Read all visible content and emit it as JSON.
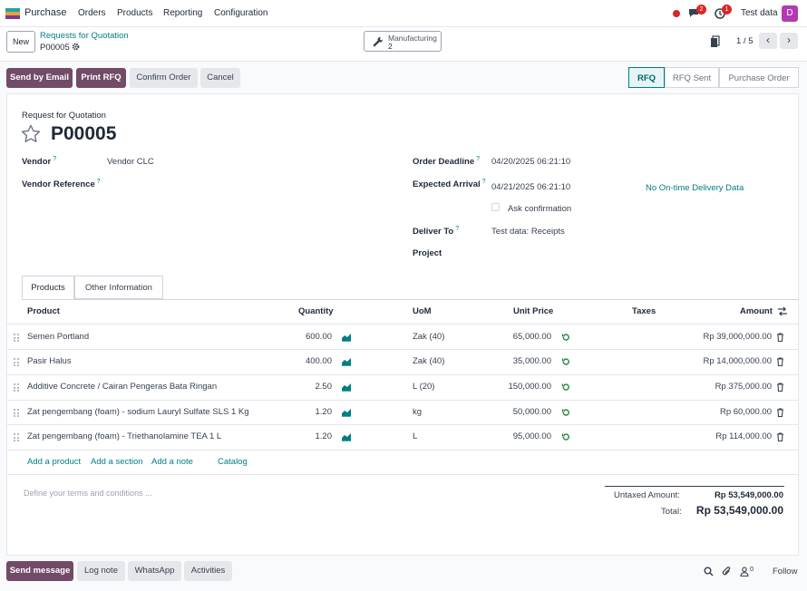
{
  "navbar": {
    "app_name": "Purchase",
    "menu": [
      "Orders",
      "Products",
      "Reporting",
      "Configuration"
    ],
    "messages_count": "2",
    "activities_count": "1",
    "company": "Test data",
    "avatar_letter": "D"
  },
  "control": {
    "new_label": "New",
    "breadcrumb": "Requests for Quotation",
    "record": "P00005",
    "smart_button": {
      "label": "Manufacturing",
      "count": "2"
    },
    "pager": "1 / 5"
  },
  "actions": {
    "send_email": "Send by Email",
    "print_rfq": "Print RFQ",
    "confirm": "Confirm Order",
    "cancel": "Cancel"
  },
  "stages": [
    "RFQ",
    "RFQ Sent",
    "Purchase Order"
  ],
  "form": {
    "doc_type": "Request for Quotation",
    "name": "P00005",
    "vendor_label": "Vendor",
    "vendor": "Vendor CLC",
    "vendor_ref_label": "Vendor Reference",
    "order_deadline_label": "Order Deadline",
    "order_deadline": "04/20/2025 06:21:10",
    "expected_arrival_label": "Expected Arrival",
    "expected_arrival": "04/21/2025 06:21:10",
    "ontime_link": "No On-time Delivery Data",
    "ask_confirmation": "Ask confirmation",
    "deliver_to_label": "Deliver To",
    "deliver_to": "Test data: Receipts",
    "project_label": "Project"
  },
  "tabs": [
    "Products",
    "Other Information"
  ],
  "table": {
    "headers": {
      "product": "Product",
      "quantity": "Quantity",
      "uom": "UoM",
      "unit_price": "Unit Price",
      "taxes": "Taxes",
      "amount": "Amount"
    },
    "rows": [
      {
        "product": "Semen Portland",
        "quantity": "600.00",
        "uom": "Zak (40)",
        "price": "65,000.00",
        "amount": "Rp 39,000,000.00"
      },
      {
        "product": "Pasir Halus",
        "quantity": "400.00",
        "uom": "Zak (40)",
        "price": "35,000.00",
        "amount": "Rp 14,000,000.00"
      },
      {
        "product": "Additive Concrete / Cairan Pengeras Bata Ringan",
        "quantity": "2.50",
        "uom": "L (20)",
        "price": "150,000.00",
        "amount": "Rp 375,000.00"
      },
      {
        "product": "Zat pengembang (foam) - sodium Lauryl Sulfate SLS 1 Kg",
        "quantity": "1.20",
        "uom": "kg",
        "price": "50,000.00",
        "amount": "Rp 60,000.00"
      },
      {
        "product": "Zat pengembang (foam) - Triethanolamine TEA 1 L",
        "quantity": "1.20",
        "uom": "L",
        "price": "95,000.00",
        "amount": "Rp 114,000.00"
      }
    ],
    "add_product": "Add a product",
    "add_section": "Add a section",
    "add_note": "Add a note",
    "catalog": "Catalog"
  },
  "terms_placeholder": "Define your terms and conditions ...",
  "totals": {
    "untaxed_label": "Untaxed Amount:",
    "untaxed": "Rp 53,549,000.00",
    "total_label": "Total:",
    "total": "Rp 53,549,000.00"
  },
  "chatter": {
    "send_message": "Send message",
    "log_note": "Log note",
    "whatsapp": "WhatsApp",
    "activities": "Activities",
    "followers_count": "0",
    "follow": "Follow"
  },
  "colors": {
    "primary": "#714b67",
    "accent": "#017e84"
  }
}
